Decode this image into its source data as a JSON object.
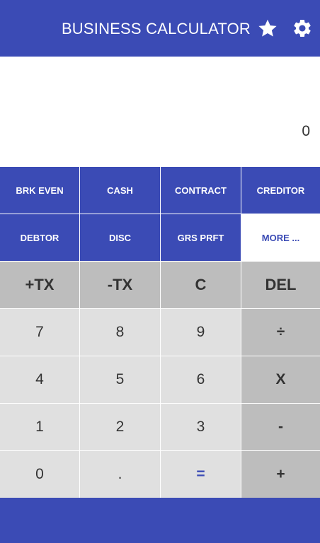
{
  "app": {
    "title": "BUSINESS CALCULATOR",
    "icons": [
      "star-icon",
      "gear-icon"
    ],
    "colors": {
      "primary": "#3b4bb5",
      "key_light": "#e0e0e0",
      "key_dark": "#bdbdbd",
      "text": "#333333"
    }
  },
  "display": {
    "value": "0"
  },
  "functions": {
    "row1": [
      "BRK EVEN",
      "CASH",
      "CONTRACT",
      "CREDITOR"
    ],
    "row2": [
      "DEBTOR",
      "DISC",
      "GRS PRFT",
      "MORE ..."
    ]
  },
  "operations": [
    "+TX",
    "-TX",
    "C",
    "DEL"
  ],
  "keypad": {
    "row1": [
      "7",
      "8",
      "9",
      "÷"
    ],
    "row2": [
      "4",
      "5",
      "6",
      "X"
    ],
    "row3": [
      "1",
      "2",
      "3",
      "-"
    ],
    "row4": [
      "0",
      ".",
      "=",
      "+"
    ]
  }
}
